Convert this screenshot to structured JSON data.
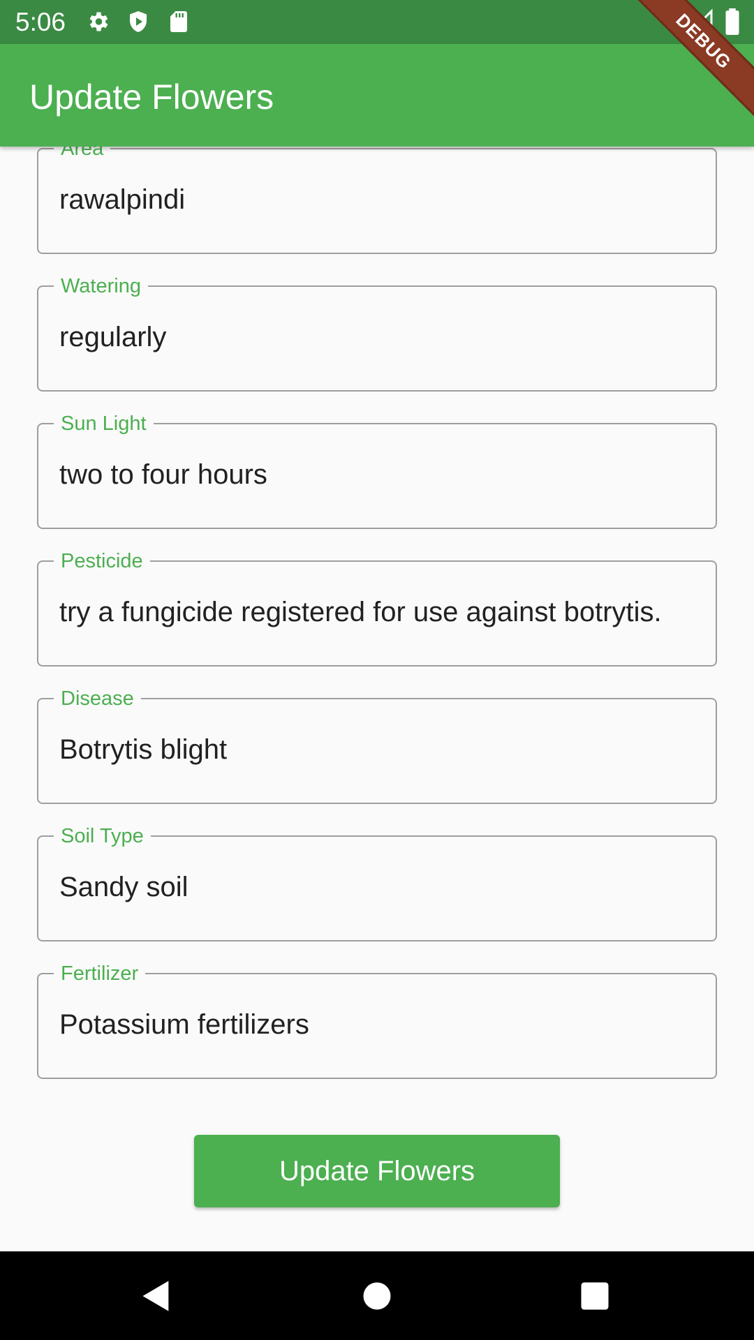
{
  "status_bar": {
    "time": "5:06",
    "icons": [
      "settings-icon",
      "shield-play-icon",
      "sd-card-icon",
      "wifi-icon",
      "signal-icon",
      "battery-icon"
    ]
  },
  "debug_banner": "DEBUG",
  "app_bar": {
    "title": "Update Flowers"
  },
  "form": {
    "fields": [
      {
        "label": "Area",
        "value": "rawalpindi"
      },
      {
        "label": "Watering",
        "value": "regularly"
      },
      {
        "label": "Sun Light",
        "value": "two to four hours"
      },
      {
        "label": "Pesticide",
        "value": "try a fungicide registered for use against botrytis."
      },
      {
        "label": "Disease",
        "value": "Botrytis blight"
      },
      {
        "label": "Soil Type",
        "value": "Sandy soil"
      },
      {
        "label": "Fertilizer",
        "value": "Potassium fertilizers"
      }
    ],
    "submit_label": "Update Flowers"
  },
  "nav_bar": {
    "icons": [
      "back-icon",
      "home-icon",
      "recents-icon"
    ]
  },
  "colors": {
    "primary": "#4caf50",
    "status_bar": "#3b8a43",
    "label": "#4caf50",
    "border": "#9e9e9e",
    "debug": "#8b3a24"
  }
}
